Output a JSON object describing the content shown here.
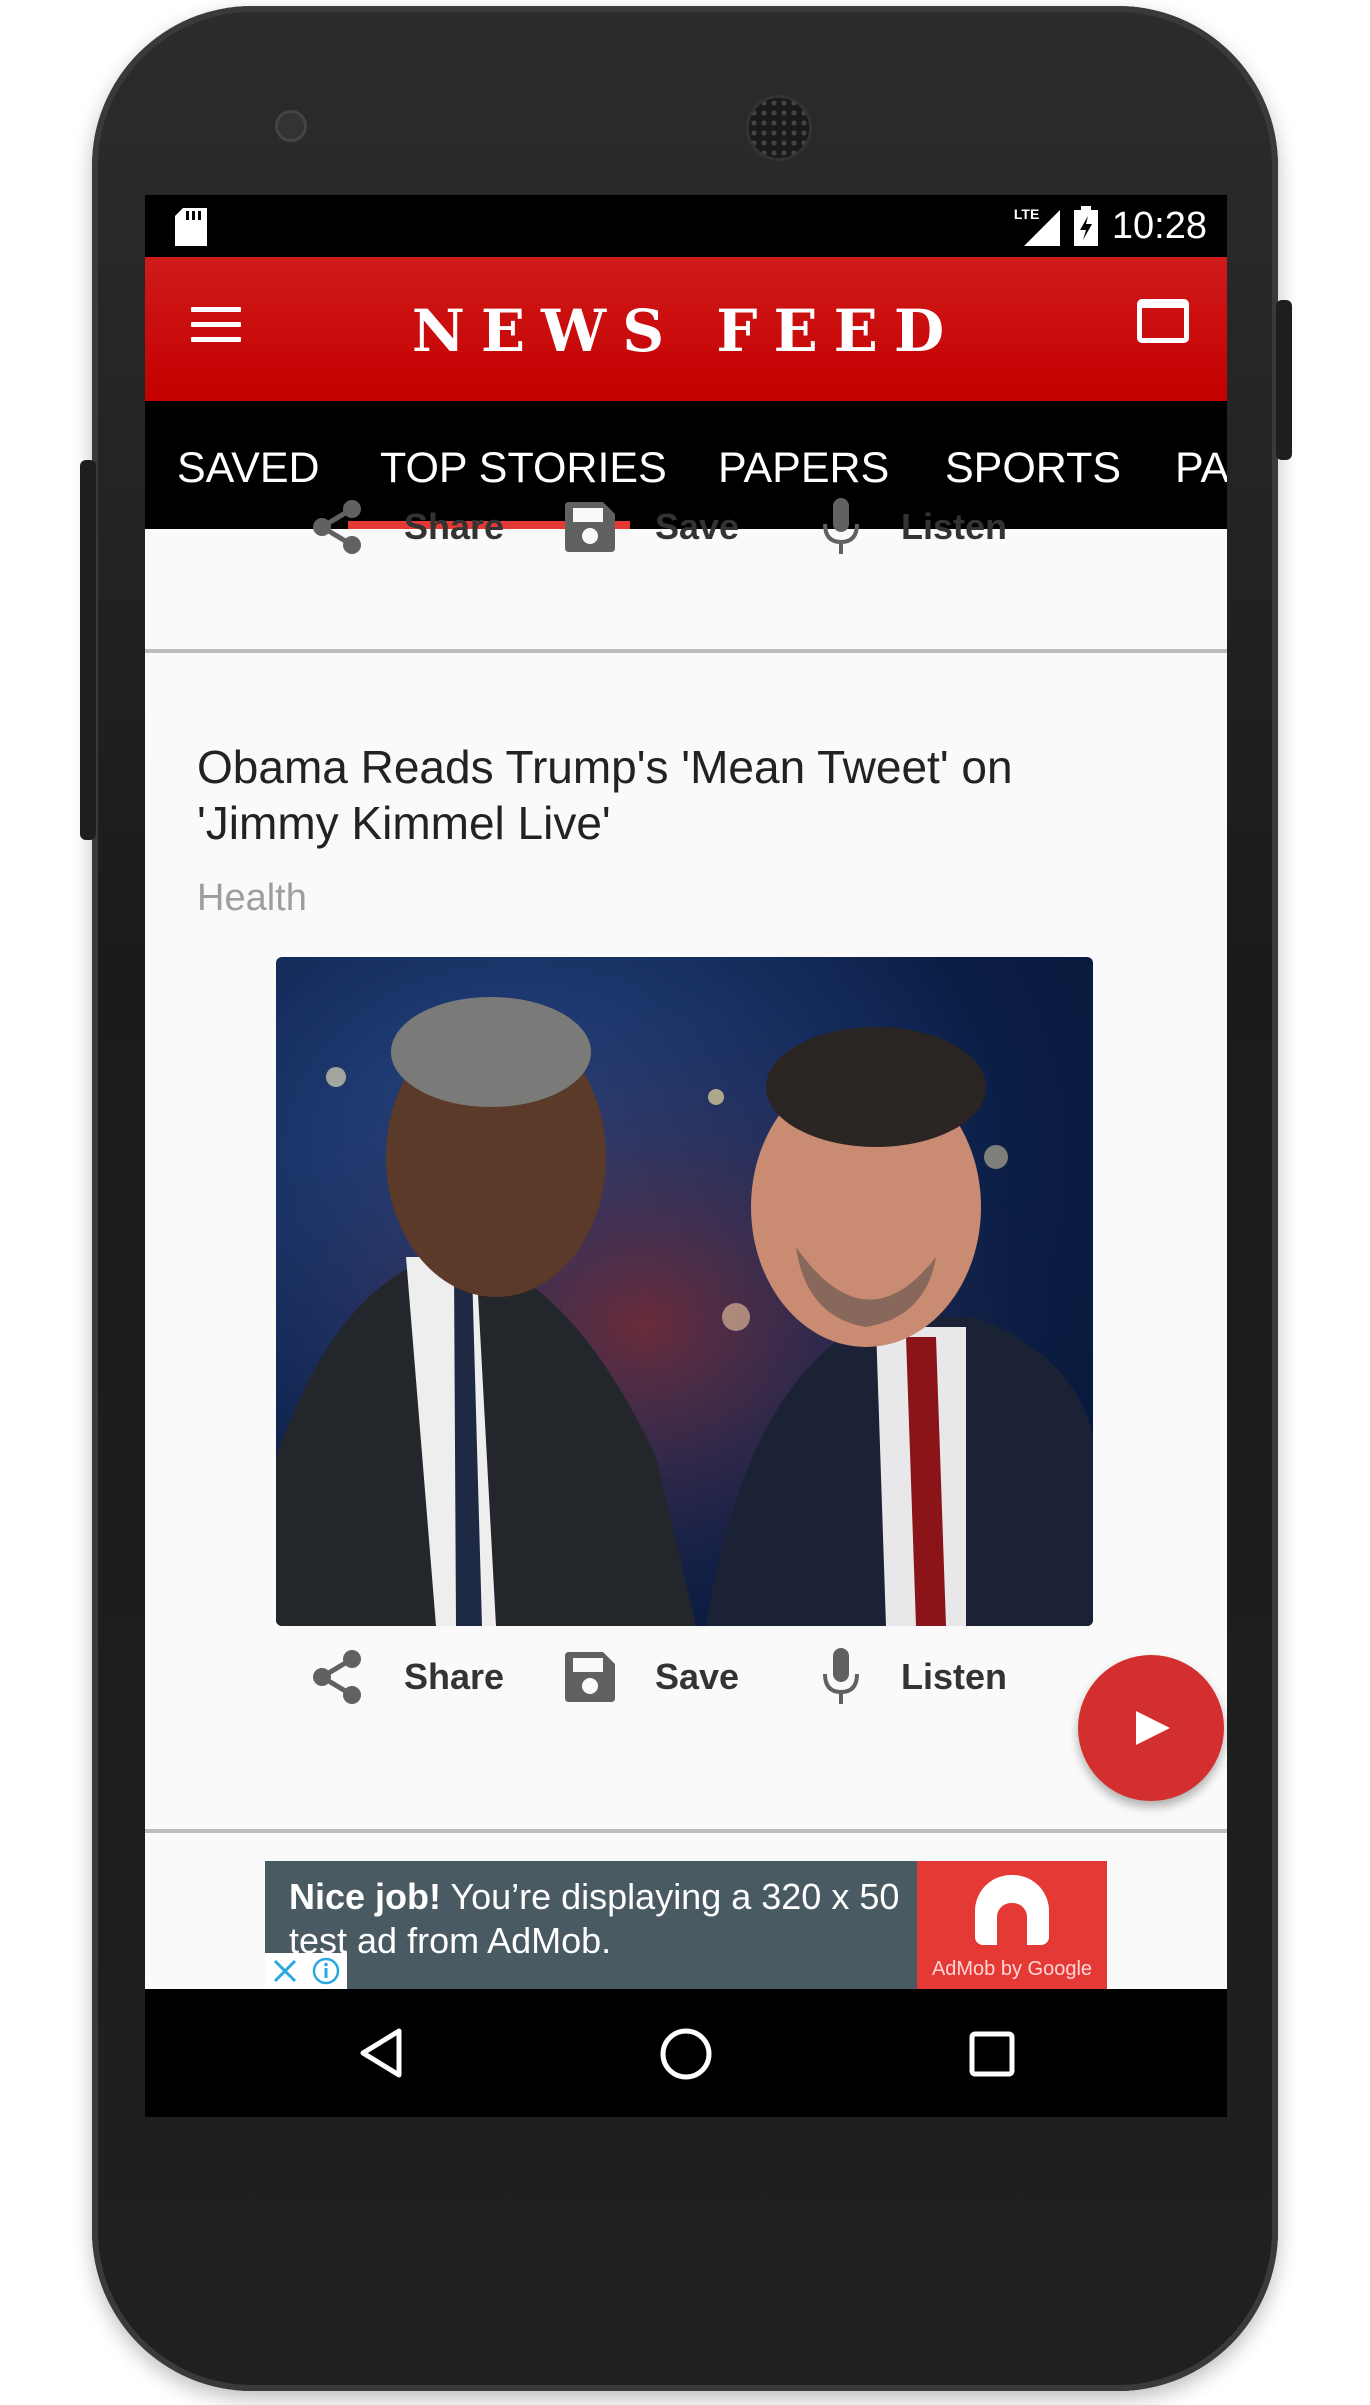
{
  "status_bar": {
    "network": "LTE",
    "time": "10:28"
  },
  "toolbar": {
    "title": "NEWS FEED"
  },
  "tabs": [
    {
      "label": "SAVED"
    },
    {
      "label": "TOP STORIES",
      "selected": true
    },
    {
      "label": "PAPERS"
    },
    {
      "label": "SPORTS"
    },
    {
      "label": "PA"
    }
  ],
  "actions": {
    "share": "Share",
    "save": "Save",
    "listen": "Listen"
  },
  "article": {
    "title": " Obama Reads Trump's 'Mean Tweet' on 'Jimmy Kimmel Live'",
    "category": "Health"
  },
  "ad": {
    "bold": "Nice job!",
    "text": " You’re displaying a 320 x 50 test ad from AdMob.",
    "logo_text": "AdMob by Google"
  },
  "colors": {
    "accent": "#c40000",
    "tab_indicator": "#e53935",
    "fab": "#d32f2f"
  }
}
